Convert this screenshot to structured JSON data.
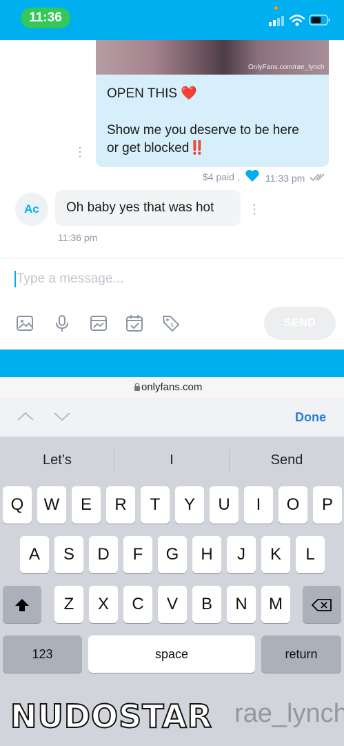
{
  "status_bar": {
    "time": "11:36"
  },
  "chat": {
    "image_watermark": "OnlyFans.com/rae_lynch",
    "outgoing": {
      "line1": "OPEN THIS ❤️",
      "line2": "Show me you deserve to be here",
      "line3": "or get blocked‼️",
      "price": "$4 paid ,",
      "time": "11:33 pm"
    },
    "incoming": {
      "avatar_initials": "Ac",
      "text": "Oh baby yes that was hot",
      "time": "11:36 pm"
    }
  },
  "composer": {
    "placeholder": "Type a message...",
    "send_label": "SEND",
    "tools": [
      "image-icon",
      "microphone-icon",
      "media-vault-icon",
      "calendar-icon",
      "price-tag-icon"
    ]
  },
  "browser": {
    "url": "onlyfans.com"
  },
  "accessory": {
    "done_label": "Done"
  },
  "keyboard": {
    "suggestions": [
      "Let’s",
      "I",
      "Send"
    ],
    "row1": [
      "Q",
      "W",
      "E",
      "R",
      "T",
      "Y",
      "U",
      "I",
      "O",
      "P"
    ],
    "row2": [
      "A",
      "S",
      "D",
      "F",
      "G",
      "H",
      "J",
      "K",
      "L"
    ],
    "row3": [
      "Z",
      "X",
      "C",
      "V",
      "B",
      "N",
      "M"
    ],
    "numbers_label": "123",
    "space_label": "space",
    "return_label": "return"
  },
  "overlay": {
    "logo_text": "NUDOSTAR",
    "username": "rae_lynch"
  },
  "colors": {
    "brand": "#00aff0",
    "status_green": "#34c759"
  }
}
